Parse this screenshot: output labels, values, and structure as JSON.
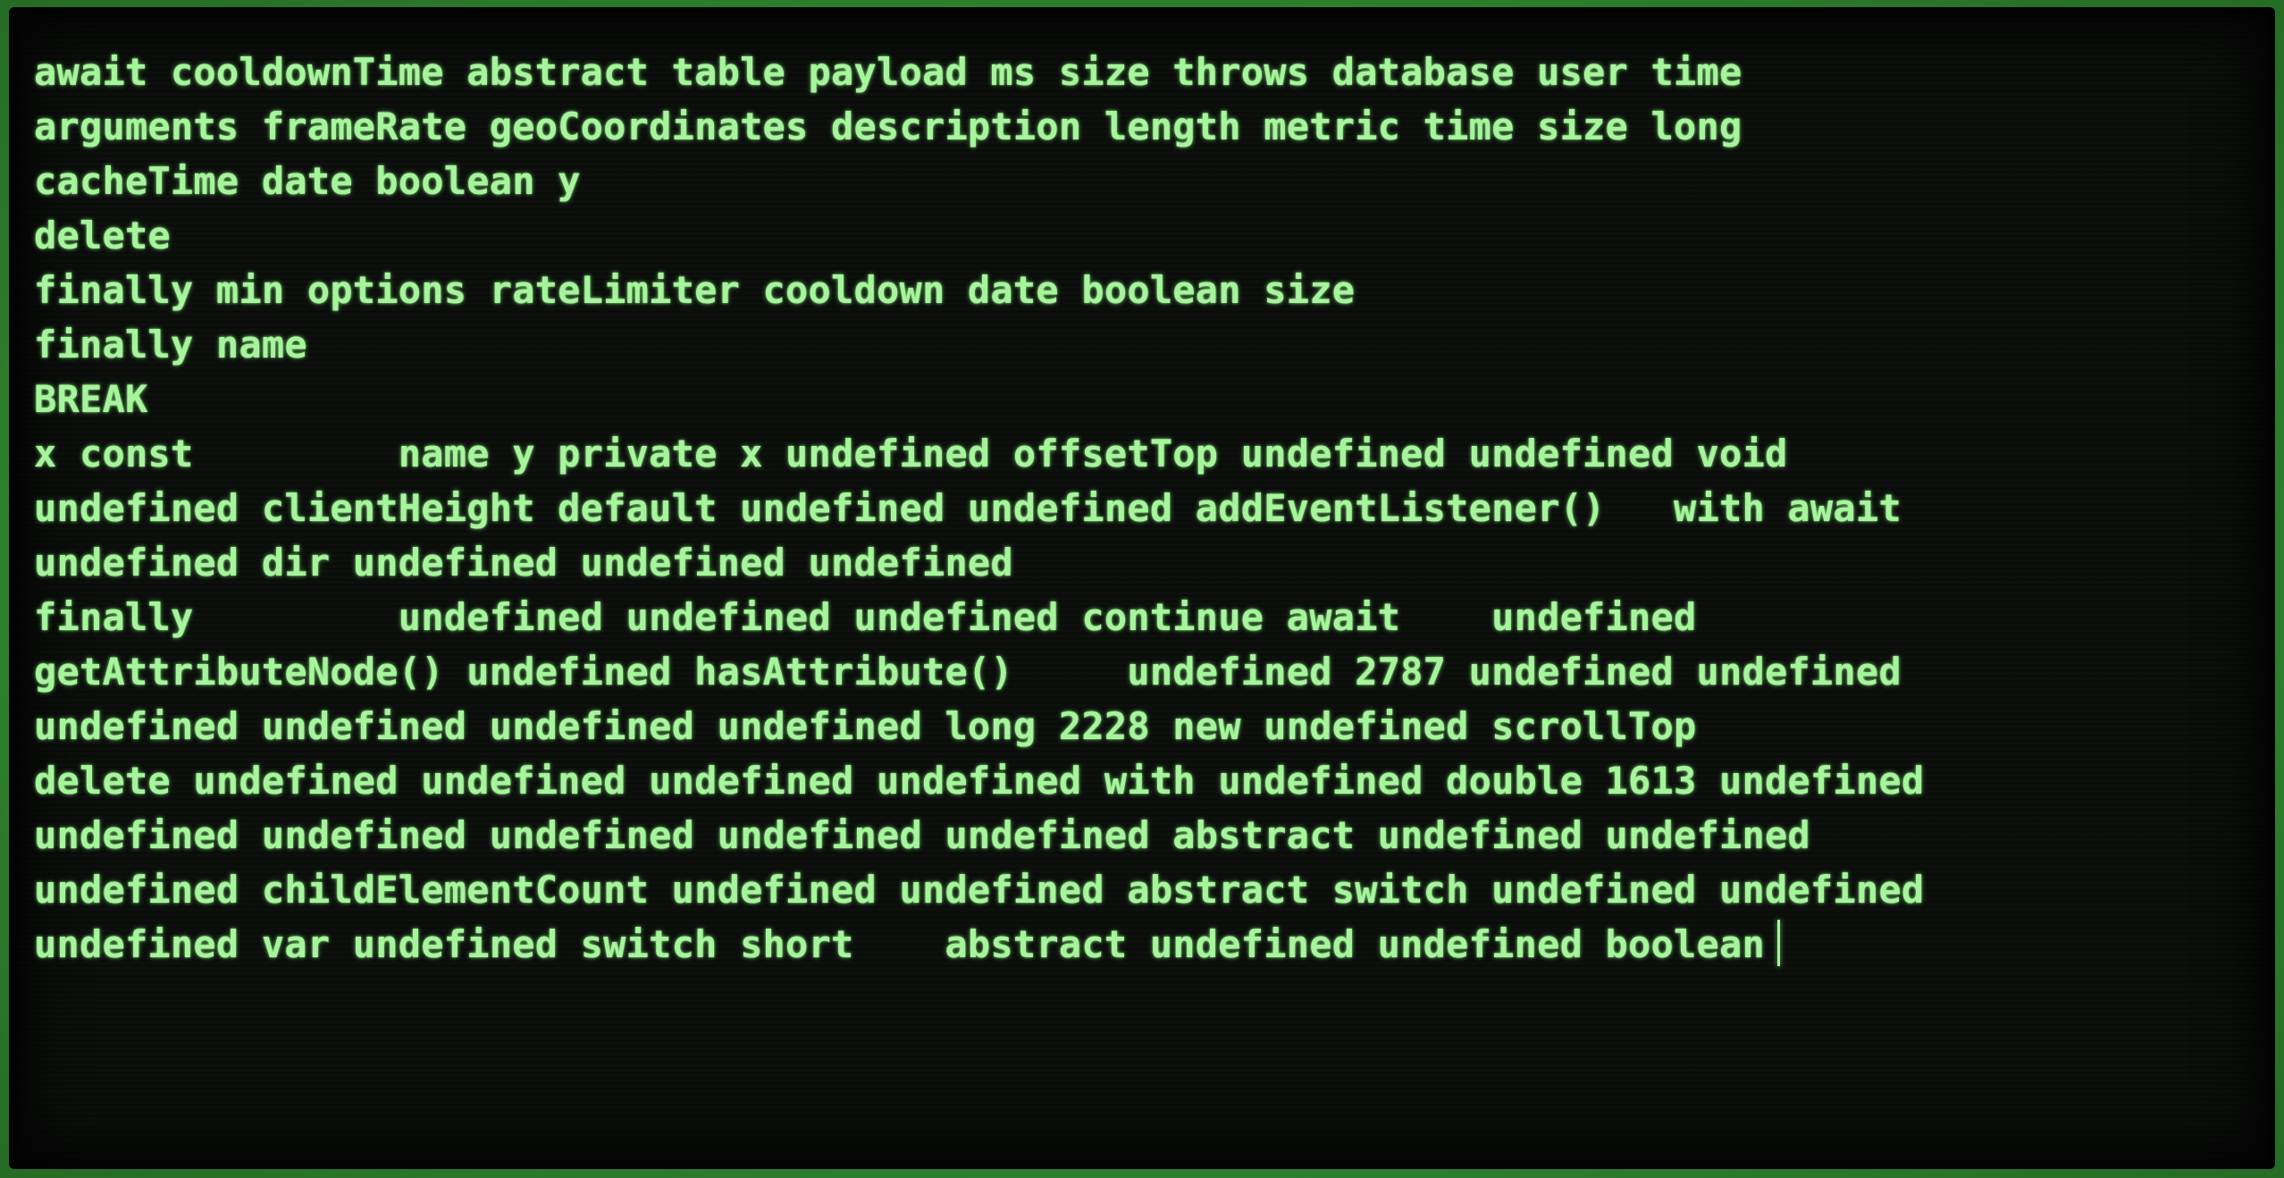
{
  "terminal": {
    "lines": [
      "await cooldownTime abstract table payload ms size throws database user time",
      "arguments frameRate geoCoordinates description length metric time size long",
      "cacheTime date boolean y",
      "delete",
      "finally min options rateLimiter cooldown date boolean size",
      "finally name",
      "BREAK",
      "x const         name y private x undefined offsetTop undefined undefined void",
      "undefined clientHeight default undefined undefined addEventListener()   with await",
      "undefined dir undefined undefined undefined",
      "finally         undefined undefined undefined continue await    undefined",
      "getAttributeNode() undefined hasAttribute()     undefined 2787 undefined undefined",
      "undefined undefined undefined undefined long 2228 new undefined scrollTop",
      "delete undefined undefined undefined undefined with undefined double 1613 undefined",
      "undefined undefined undefined undefined undefined abstract undefined undefined",
      "undefined childElementCount undefined undefined abstract switch undefined undefined",
      "undefined var undefined switch short    abstract undefined undefined boolean"
    ]
  },
  "colors": {
    "text": "#a6f59c",
    "background": "#0d100d",
    "bezel": "#2f8a2f"
  }
}
